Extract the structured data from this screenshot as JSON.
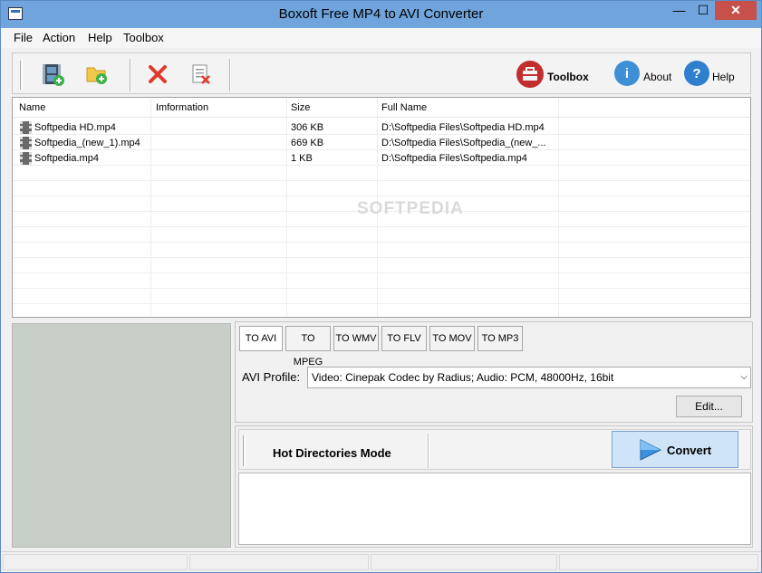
{
  "window": {
    "title": "Boxoft Free MP4 to AVI Converter",
    "minimize_glyph": "—",
    "maximize_glyph": "☐",
    "close_glyph": "✕"
  },
  "menu": {
    "items": [
      "File",
      "Action",
      "Help",
      "Toolbox"
    ]
  },
  "toolbar": {
    "add_video_icon": "film-add-icon",
    "add_folder_icon": "folder-add-icon",
    "remove_icon": "red-x-icon",
    "clear_icon": "clear-list-icon",
    "toolbox_label": "Toolbox",
    "about_label": "About",
    "help_label": "Help",
    "about_glyph": "i",
    "help_glyph": "?"
  },
  "filelist": {
    "columns": [
      "Name",
      "Imformation",
      "Size",
      "Full Name"
    ],
    "rows": [
      {
        "name": "Softpedia HD.mp4",
        "info": "",
        "size": "306 KB",
        "full": "D:\\Softpedia Files\\Softpedia HD.mp4"
      },
      {
        "name": "Softpedia_(new_1).mp4",
        "info": "",
        "size": "669 KB",
        "full": "D:\\Softpedia Files\\Softpedia_(new_..."
      },
      {
        "name": "Softpedia.mp4",
        "info": "",
        "size": "1 KB",
        "full": "D:\\Softpedia Files\\Softpedia.mp4"
      }
    ],
    "watermark": "SOFTPEDIA"
  },
  "formats": {
    "tabs": [
      "TO AVI",
      "TO MPEG",
      "TO WMV",
      "TO FLV",
      "TO MOV",
      "TO MP3"
    ],
    "active": "TO AVI",
    "profile_label": "AVI Profile:",
    "profile_value": "Video: Cinepak Codec by Radius; Audio: PCM, 48000Hz, 16bit",
    "edit_label": "Edit..."
  },
  "convert": {
    "mode_label": "Hot Directories Mode",
    "convert_label": "Convert"
  },
  "colors": {
    "titlebar": "#6fa4dc",
    "close": "#c7504a",
    "convert_bg": "#cfe4f7",
    "preview_bg": "#c8cfc8"
  }
}
